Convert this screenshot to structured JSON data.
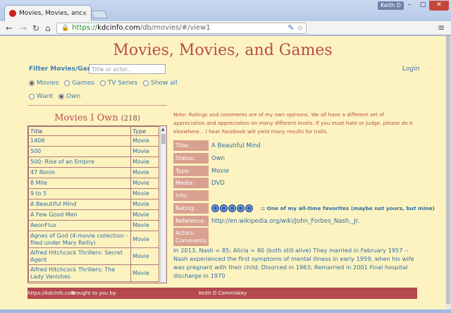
{
  "browser": {
    "tab_title": "Movies, Movies, and Gam",
    "tab_close": "×",
    "user": "Keith D",
    "win_min": "–",
    "win_max": "□",
    "win_close": "✕",
    "nav": {
      "back": "←",
      "forward": "→",
      "reload": "↻",
      "home": "⌂",
      "menu": "≡"
    },
    "url": {
      "scheme": "https://",
      "host": "kdcinfo.com",
      "path": "/db/movies/#/view1"
    },
    "colors": {
      "close": "#c7463a",
      "secure": "#1c8a1c"
    }
  },
  "page": {
    "title": "Movies, Movies, and Games",
    "login": "Login",
    "filter": {
      "label": "Filter Movies/Games:",
      "placeholder": "Title or actor..."
    },
    "category_options": [
      {
        "label": "Movies",
        "checked": true
      },
      {
        "label": "Games",
        "checked": false
      },
      {
        "label": "TV Series",
        "checked": false
      },
      {
        "label": "Show all",
        "checked": false
      }
    ],
    "status_options": [
      {
        "label": "Want",
        "checked": false
      },
      {
        "label": "Own",
        "checked": true
      }
    ],
    "colors": {
      "title": "#b74d4d",
      "link": "#2f6ea0",
      "label_bg": "#d9a08f",
      "footer_bg": "#b3494c",
      "page_bg": "#fdf3c1"
    }
  },
  "list": {
    "title": "Movies I Own",
    "count": "(218)",
    "headers": {
      "title": "Title",
      "type": "Type"
    },
    "rows": [
      {
        "title": "1408",
        "type": "Movie"
      },
      {
        "title": "500",
        "type": "Movie"
      },
      {
        "title": "500: Rise of an Empire",
        "type": "Movie"
      },
      {
        "title": "47 Ronin",
        "type": "Movie"
      },
      {
        "title": "8 Mile",
        "type": "Movie"
      },
      {
        "title": "9 to 5",
        "type": "Movie"
      },
      {
        "title": "A Beautiful Mind",
        "type": "Movie"
      },
      {
        "title": "A Few Good Men",
        "type": "Movie"
      },
      {
        "title": "AeonFlux",
        "type": "Movie"
      },
      {
        "title": "Agnes of God (4-movie collection - filed under Mary Reilly)",
        "type": "Movie"
      },
      {
        "title": "Alfred Hitchcock Thrillers: Secret Agent",
        "type": "Movie"
      },
      {
        "title": "Alfred Hitchcock Thrillers: The Lady Vanishes",
        "type": "Movie"
      }
    ]
  },
  "detail": {
    "note": "Note: Ratings and comments are of my own opinions. We all have a different set of appreciation and appreciation on many different levels. If you must hate or judge, please do it elsewhere... I hear Facebook will yield many results for trolls.",
    "labels": {
      "title": "Title:",
      "status": "Status:",
      "type": "Type:",
      "media": "Media:",
      "info": "Info:",
      "rating": "Rating:",
      "reference": "Reference:",
      "actors": "Actors:",
      "comments": "Comments:"
    },
    "values": {
      "title": "A Beautiful Mind",
      "status": "Own",
      "type": "Movie",
      "media": "DVD",
      "info": "",
      "rating_text": ":: One of my all-time favorites (maybe not yours, but mine)",
      "reference": "http://en.wikipedia.org/wiki/John_Forbes_Nash,_Jr.",
      "actors": ""
    },
    "rating": {
      "value": 5,
      "max": 5,
      "icon": "disc-icon"
    },
    "comment": "In 2013, Nash = 85; Alicia = 80 (both still alive) They married in February 1957 -- Nash experienced the first symptoms of mental illness in early 1959, when his wife was pregnant with their child. Divorced in 1963; Remarried in 2001 Final hospital discharge in 1970"
  },
  "footer": {
    "brought": "Brought to you by:",
    "author": "Keith D Commiskey",
    "site": "https://kdcinfo.com"
  }
}
